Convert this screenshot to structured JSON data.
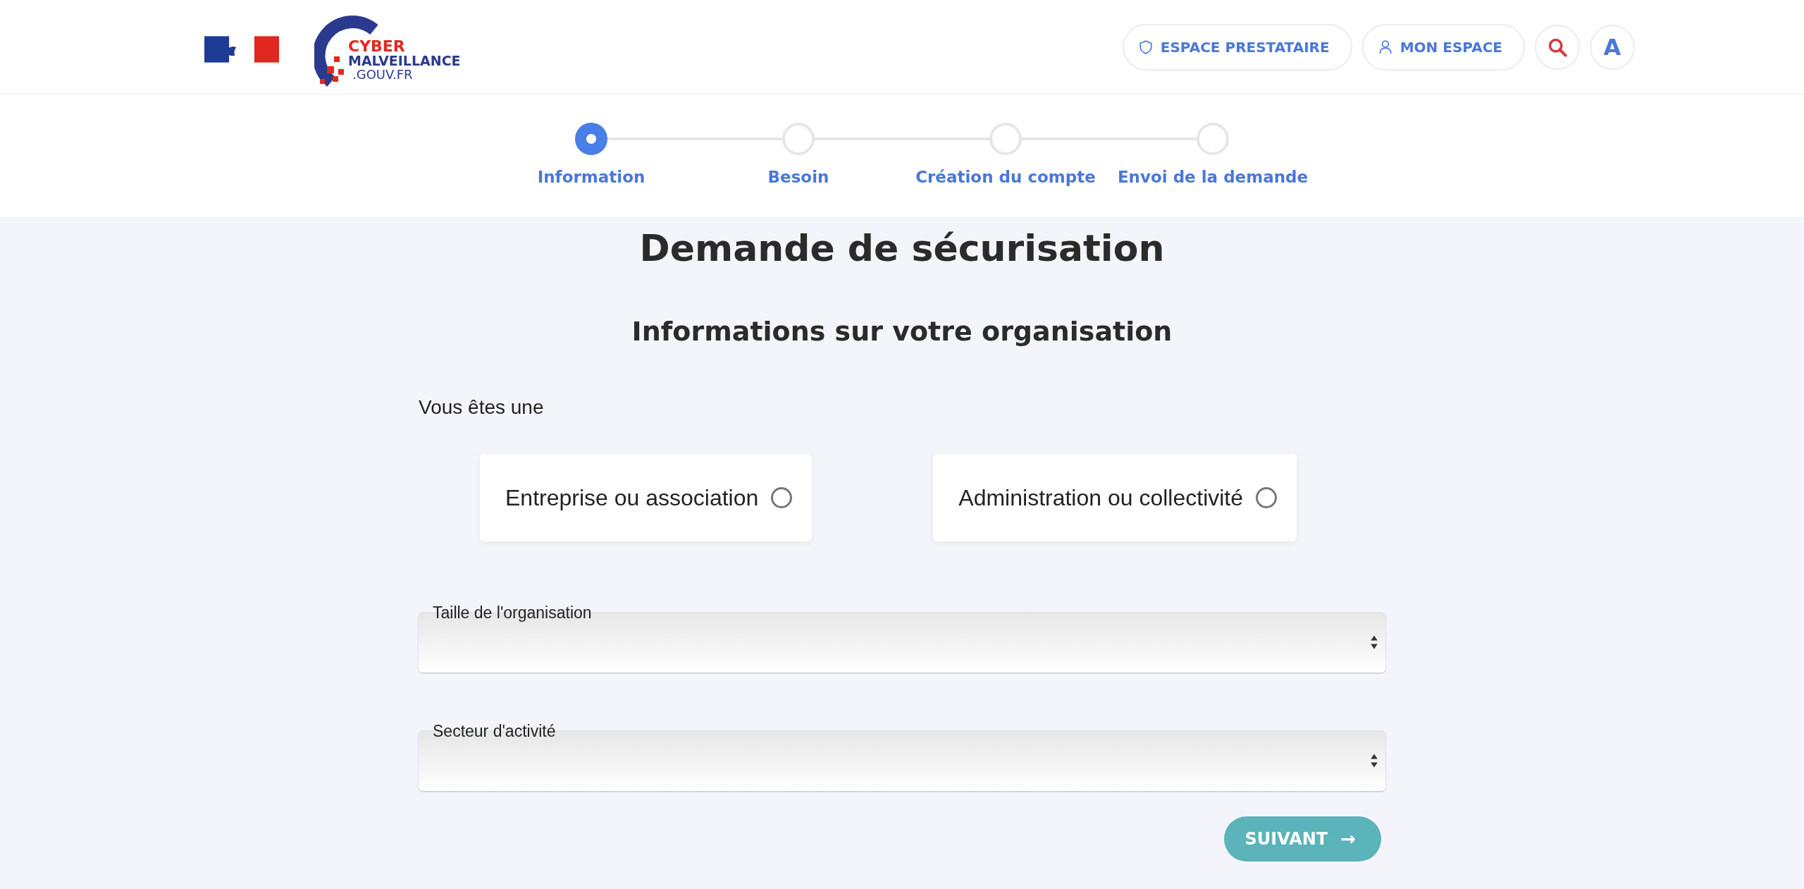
{
  "header": {
    "logo": {
      "line_1": "CYBER",
      "line_2": "MALVEILLANCE",
      "line_3": ".GOUV.FR"
    },
    "buttons": [
      {
        "kind": "shield",
        "label": "ESPACE PRESTATAIRE"
      },
      {
        "kind": "person",
        "label": "MON ESPACE"
      },
      {
        "kind": "search"
      },
      {
        "kind": "letter",
        "label": "A"
      }
    ]
  },
  "stepper": [
    {
      "label": "Information",
      "selected": true
    },
    {
      "label": "Besoin",
      "selected": false
    },
    {
      "label": "Création du compte",
      "selected": false
    },
    {
      "label": "Envoi de la demande",
      "selected": false
    }
  ],
  "title": "Demande de sécurisation",
  "subtitle": "Informations sur votre organisation",
  "question": "Vous êtes une",
  "options": [
    {
      "label": "Entreprise ou association",
      "selected": false
    },
    {
      "label": "Administration ou collectivité",
      "selected": false
    }
  ],
  "selects": [
    {
      "label": "Taille de l'organisation"
    },
    {
      "label": "Secteur d'activité"
    }
  ],
  "next_button": {
    "label": "SUIVANT",
    "arrow": "→"
  }
}
